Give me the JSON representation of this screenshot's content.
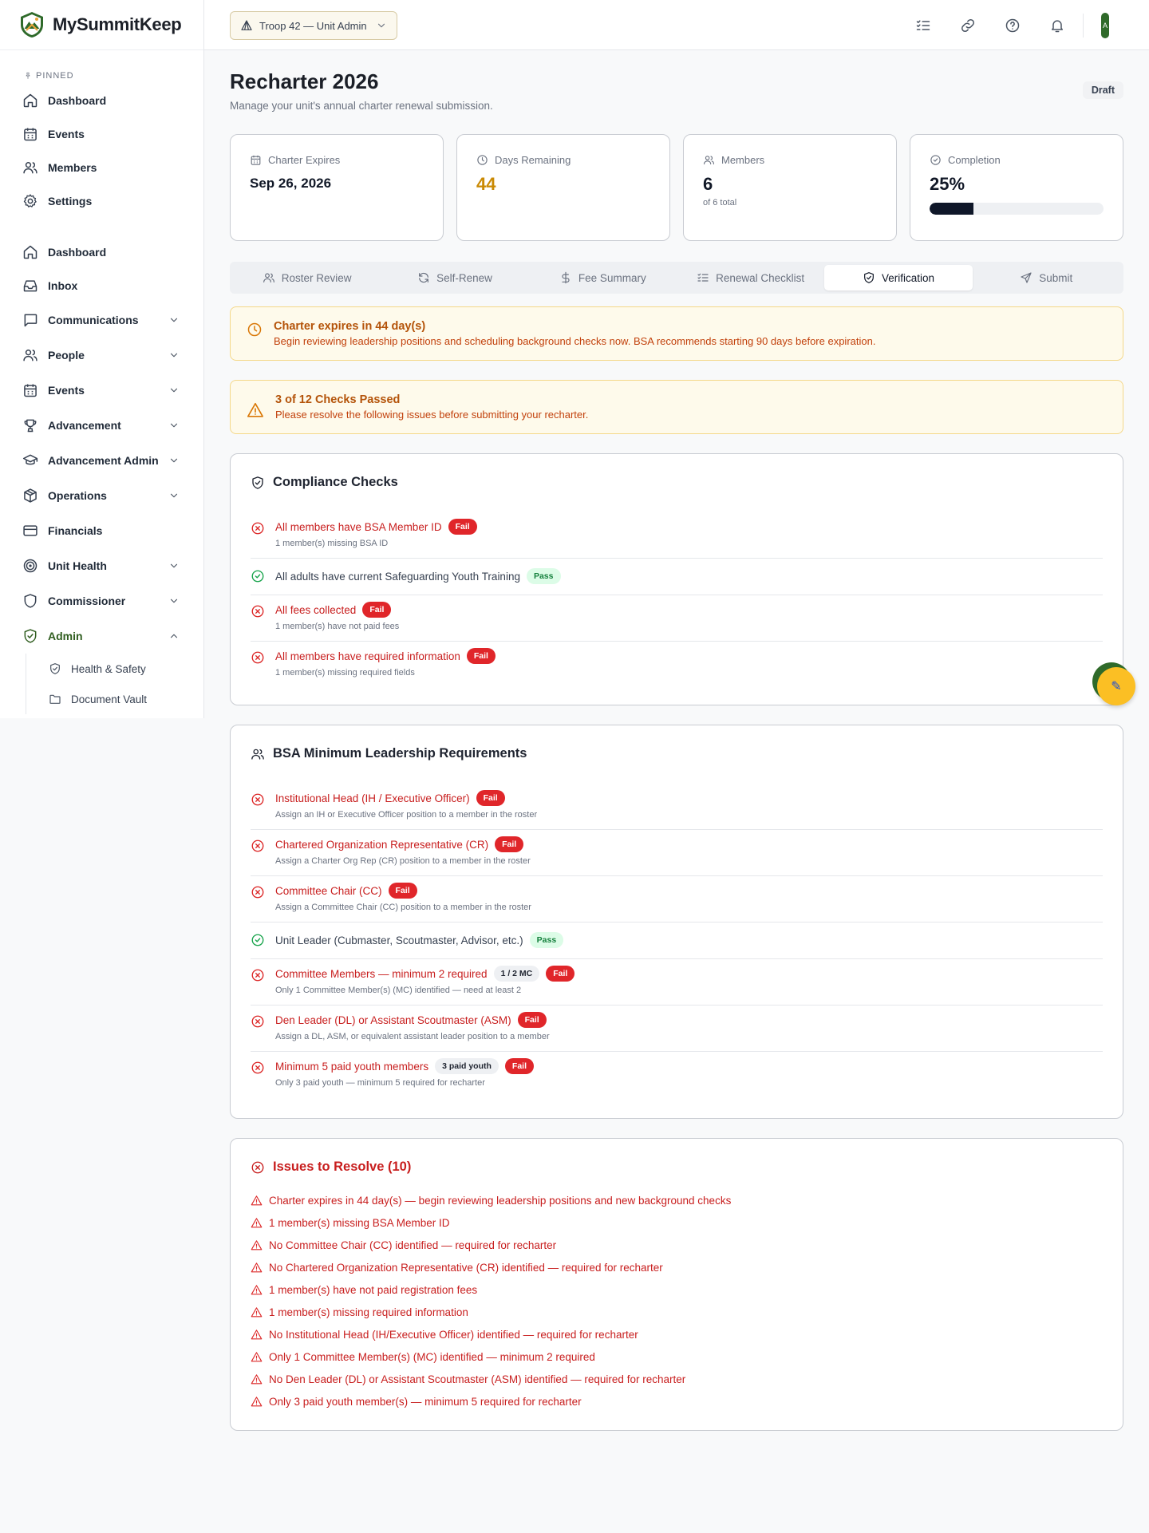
{
  "app": {
    "name": "MySummitKeep"
  },
  "topbar": {
    "unit_select": "Troop 42 — Unit Admin",
    "avatar_initial": "A"
  },
  "sidebar": {
    "pinned_label": "PINNED",
    "pinned": [
      {
        "label": "Dashboard",
        "icon": "home-icon"
      },
      {
        "label": "Events",
        "icon": "calendar-icon"
      },
      {
        "label": "Members",
        "icon": "users-icon"
      },
      {
        "label": "Settings",
        "icon": "gear-icon"
      }
    ],
    "items": [
      {
        "label": "Dashboard",
        "icon": "home-icon",
        "chevron": false
      },
      {
        "label": "Inbox",
        "icon": "inbox-icon",
        "chevron": false
      },
      {
        "label": "Communications",
        "icon": "message-icon",
        "chevron": true
      },
      {
        "label": "People",
        "icon": "users-icon",
        "chevron": true
      },
      {
        "label": "Events",
        "icon": "calendar-icon",
        "chevron": true
      },
      {
        "label": "Advancement",
        "icon": "trophy-icon",
        "chevron": true
      },
      {
        "label": "Advancement Admin",
        "icon": "graduation-cap-icon",
        "chevron": true
      },
      {
        "label": "Operations",
        "icon": "box-icon",
        "chevron": true
      },
      {
        "label": "Financials",
        "icon": "credit-card-icon",
        "chevron": false
      },
      {
        "label": "Unit Health",
        "icon": "target-icon",
        "chevron": true
      },
      {
        "label": "Commissioner",
        "icon": "shield-icon",
        "chevron": true
      },
      {
        "label": "Admin",
        "icon": "shield-check-icon",
        "chevron": true,
        "expanded": true
      }
    ],
    "admin_sub": [
      {
        "label": "Health & Safety",
        "icon": "shield-check-icon"
      },
      {
        "label": "Document Vault",
        "icon": "folder-icon"
      }
    ]
  },
  "page": {
    "title": "Recharter 2026",
    "subtitle": "Manage your unit's annual charter renewal submission.",
    "status": "Draft"
  },
  "stats": {
    "charter": {
      "label": "Charter Expires",
      "value": "Sep 26, 2026"
    },
    "days": {
      "label": "Days Remaining",
      "value": "44"
    },
    "members": {
      "label": "Members",
      "value": "6",
      "note": "of 6 total"
    },
    "completion": {
      "label": "Completion",
      "value": "25%",
      "fraction": 0.25
    }
  },
  "tabs": [
    {
      "label": "Roster Review",
      "icon": "users-icon"
    },
    {
      "label": "Self-Renew",
      "icon": "refresh-icon"
    },
    {
      "label": "Fee Summary",
      "icon": "dollar-icon"
    },
    {
      "label": "Renewal Checklist",
      "icon": "checklist-icon"
    },
    {
      "label": "Verification",
      "icon": "shield-check-icon",
      "active": true
    },
    {
      "label": "Submit",
      "icon": "send-icon"
    }
  ],
  "alerts": {
    "expiry": {
      "title": "Charter expires in 44 day(s)",
      "text": "Begin reviewing leadership positions and scheduling background checks now. BSA recommends starting 90 days before expiration."
    },
    "checks": {
      "title": "3 of 12 Checks Passed",
      "text": "Please resolve the following issues before submitting your recharter."
    }
  },
  "compliance": {
    "title": "Compliance Checks",
    "rows": [
      {
        "label": "All members have BSA Member ID",
        "status": "Fail",
        "sub": "1 member(s) missing BSA ID"
      },
      {
        "label": "All adults have current Safeguarding Youth Training",
        "status": "Pass",
        "sub": ""
      },
      {
        "label": "All fees collected",
        "status": "Fail",
        "sub": "1 member(s) have not paid fees"
      },
      {
        "label": "All members have required information",
        "status": "Fail",
        "sub": "1 member(s) missing required fields"
      }
    ]
  },
  "leadership": {
    "title": "BSA Minimum Leadership Requirements",
    "rows": [
      {
        "label": "Institutional Head (IH / Executive Officer)",
        "status": "Fail",
        "sub": "Assign an IH or Executive Officer position to a member in the roster",
        "count": ""
      },
      {
        "label": "Chartered Organization Representative (CR)",
        "status": "Fail",
        "sub": "Assign a Charter Org Rep (CR) position to a member in the roster",
        "count": ""
      },
      {
        "label": "Committee Chair (CC)",
        "status": "Fail",
        "sub": "Assign a Committee Chair (CC) position to a member in the roster",
        "count": ""
      },
      {
        "label": "Unit Leader (Cubmaster, Scoutmaster, Advisor, etc.)",
        "status": "Pass",
        "sub": "",
        "count": ""
      },
      {
        "label": "Committee Members — minimum 2 required",
        "status": "Fail",
        "sub": "Only 1 Committee Member(s) (MC) identified — need at least 2",
        "count": "1 / 2 MC"
      },
      {
        "label": "Den Leader (DL) or Assistant Scoutmaster (ASM)",
        "status": "Fail",
        "sub": "Assign a DL, ASM, or equivalent assistant leader position to a member",
        "count": ""
      },
      {
        "label": "Minimum 5 paid youth members",
        "status": "Fail",
        "sub": "Only 3 paid youth — minimum 5 required for recharter",
        "count": "3 paid youth"
      }
    ]
  },
  "issues": {
    "title": "Issues to Resolve (10)",
    "items": [
      "Charter expires in 44 day(s) — begin reviewing leadership positions and new background checks",
      "1 member(s) missing BSA Member ID",
      "No Committee Chair (CC) identified — required for recharter",
      "No Chartered Organization Representative (CR) identified — required for recharter",
      "1 member(s) have not paid registration fees",
      "1 member(s) missing required information",
      "No Institutional Head (IH/Executive Officer) identified — required for recharter",
      "Only 1 Committee Member(s) (MC) identified — minimum 2 required",
      "No Den Leader (DL) or Assistant Scoutmaster (ASM) identified — required for recharter",
      "Only 3 paid youth member(s) — minimum 5 required for recharter"
    ]
  },
  "colors": {
    "brand_green": "#2f6a2a",
    "fail_red": "#e0262a",
    "warning_amber": "#d97706",
    "progress_fill": "#0f1729"
  }
}
